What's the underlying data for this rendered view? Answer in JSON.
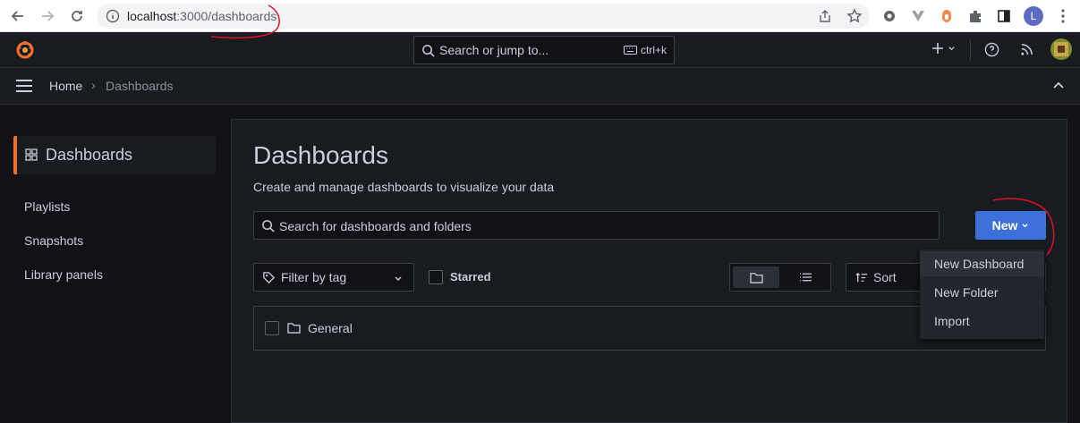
{
  "browser": {
    "url_host": "localhost",
    "url_path": ":3000/dashboards",
    "profile_initial": "L"
  },
  "topbar": {
    "search_placeholder": "Search or jump to...",
    "shortcut": "ctrl+k"
  },
  "breadcrumb": {
    "home": "Home",
    "separator": "›",
    "current": "Dashboards"
  },
  "sidebar": {
    "active": "Dashboards",
    "items": [
      {
        "label": "Playlists"
      },
      {
        "label": "Snapshots"
      },
      {
        "label": "Library panels"
      }
    ]
  },
  "main": {
    "title": "Dashboards",
    "subtitle": "Create and manage dashboards to visualize your data",
    "search_placeholder": "Search for dashboards and folders",
    "new_button": "New",
    "tag_filter_placeholder": "Filter by tag",
    "starred_label": "Starred",
    "sort_placeholder": "Sort",
    "folders": [
      {
        "name": "General"
      }
    ]
  },
  "new_menu": {
    "items": [
      {
        "label": "New Dashboard"
      },
      {
        "label": "New Folder"
      },
      {
        "label": "Import"
      }
    ]
  },
  "colors": {
    "accent_orange": "#f46f2f",
    "primary_blue": "#3d71d9",
    "annotation_red": "#e0102a"
  }
}
